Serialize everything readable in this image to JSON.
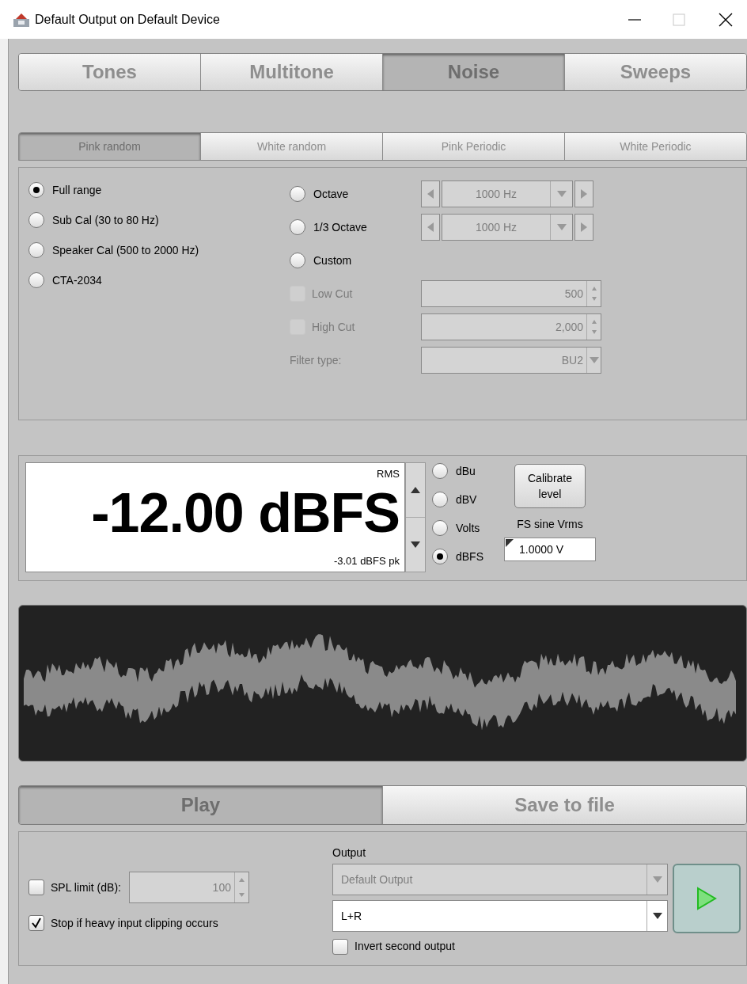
{
  "window": {
    "title": "Default Output on Default Device"
  },
  "tabs": [
    {
      "label": "Tones",
      "selected": false
    },
    {
      "label": "Multitone",
      "selected": false
    },
    {
      "label": "Noise",
      "selected": true
    },
    {
      "label": "Sweeps",
      "selected": false
    }
  ],
  "noise_types": [
    {
      "label": "Pink random",
      "selected": true
    },
    {
      "label": "White random",
      "selected": false
    },
    {
      "label": "Pink Periodic",
      "selected": false
    },
    {
      "label": "White Periodic",
      "selected": false
    }
  ],
  "range_options": [
    {
      "label": "Full range",
      "selected": true
    },
    {
      "label": "Sub Cal (30 to 80 Hz)",
      "selected": false
    },
    {
      "label": "Speaker Cal (500 to 2000 Hz)",
      "selected": false
    },
    {
      "label": "CTA-2034",
      "selected": false
    }
  ],
  "band_options": [
    {
      "label": "Octave",
      "selected": false,
      "frequency": "1000 Hz"
    },
    {
      "label": "1/3 Octave",
      "selected": false,
      "frequency": "1000 Hz"
    },
    {
      "label": "Custom",
      "selected": false
    }
  ],
  "filters": [
    {
      "kind": "checkbox",
      "label": "Low Cut",
      "checked": false,
      "disabled": true,
      "value": "500"
    },
    {
      "kind": "checkbox",
      "label": "High Cut",
      "checked": false,
      "disabled": true,
      "value": "2,000"
    },
    {
      "kind": "select",
      "label": "Filter type:",
      "disabled": true,
      "value": "BU2"
    }
  ],
  "level": {
    "mode": "RMS",
    "value": "-12.00 dBFS",
    "peak": "-3.01 dBFS pk"
  },
  "units": [
    {
      "label": "dBu",
      "selected": false
    },
    {
      "label": "dBV",
      "selected": false
    },
    {
      "label": "Volts",
      "selected": false
    },
    {
      "label": "dBFS",
      "selected": true
    }
  ],
  "calibrate_button": "Calibrate level",
  "fs_sine": {
    "label": "FS sine Vrms",
    "value": "1.0000 V"
  },
  "actions": [
    {
      "label": "Play",
      "selected": true
    },
    {
      "label": "Save to file",
      "selected": false
    }
  ],
  "spl_limit": {
    "label": "SPL limit (dB):",
    "checked": false,
    "disabled": true,
    "value": "100"
  },
  "stop_clipping": {
    "label": "Stop if heavy input clipping occurs",
    "checked": true
  },
  "output": {
    "label": "Output",
    "device": {
      "value": "Default Output",
      "disabled": true
    },
    "channels": {
      "value": "L+R",
      "disabled": false
    }
  },
  "invert_second": {
    "label": "Invert second output",
    "checked": false
  }
}
